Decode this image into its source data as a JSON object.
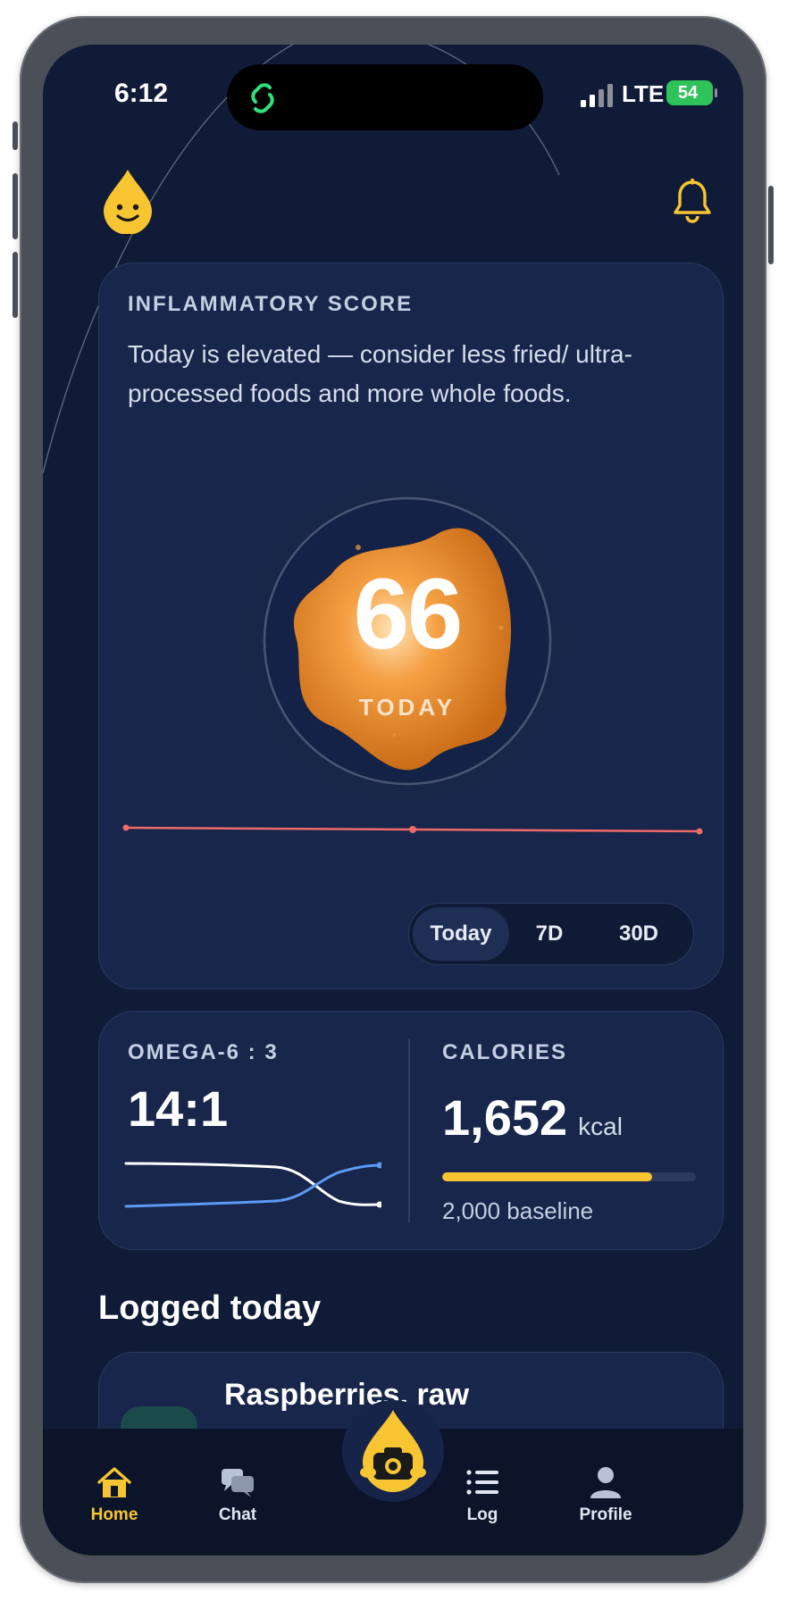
{
  "status_bar": {
    "time": "6:12",
    "network": "LTE",
    "battery": "54"
  },
  "score": {
    "title": "INFLAMMATORY SCORE",
    "description": "Today is elevated — consider less fried/ ultra-processed foods and more whole foods.",
    "value": "66",
    "value_label": "TODAY",
    "ranges": [
      "Today",
      "7D",
      "30D"
    ],
    "selected_range": "Today"
  },
  "omega": {
    "title": "OMEGA-6 : 3",
    "value": "14:1"
  },
  "calories": {
    "title": "CALORIES",
    "value": "1,652",
    "unit": "kcal",
    "baseline": "2,000 baseline",
    "progress": 0.826
  },
  "logged": {
    "title": "Logged today",
    "items": [
      {
        "name": "Raspberries, raw"
      }
    ]
  },
  "tabs": [
    {
      "label": "Home",
      "icon": "home-icon"
    },
    {
      "label": "Chat",
      "icon": "chat-icon"
    },
    {
      "label": "",
      "icon": "camera-icon"
    },
    {
      "label": "Log",
      "icon": "list-icon"
    },
    {
      "label": "Profile",
      "icon": "profile-icon"
    }
  ],
  "colors": {
    "background": "#101c37",
    "card": "#17264a",
    "accent": "#f7c531",
    "orb": "#e88a2a",
    "trend": "#f06a6a",
    "omega6": "#ffffff",
    "omega3": "#5b9bf5"
  }
}
